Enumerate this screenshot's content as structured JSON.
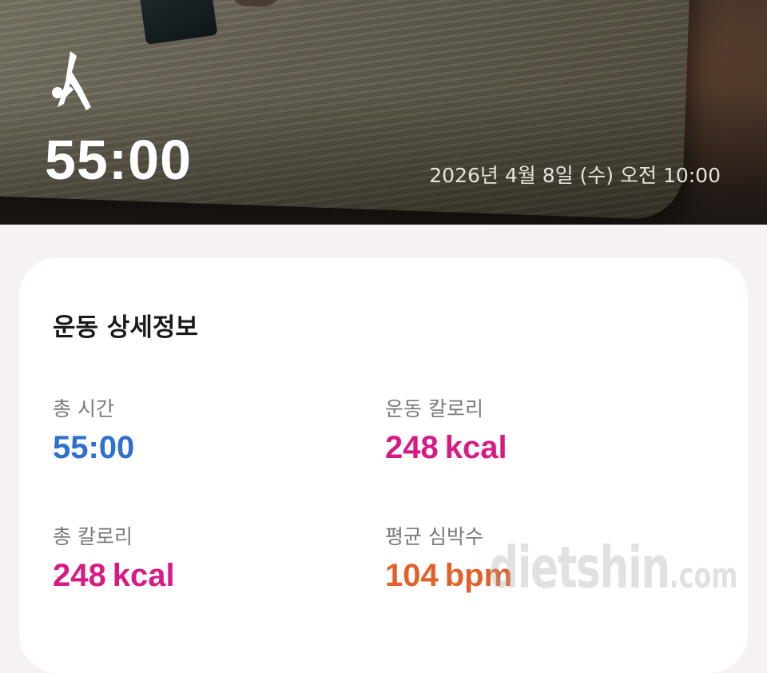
{
  "hero": {
    "icon": "yoga-icon",
    "duration": "55:00",
    "date": "2026년 4월 8일 (수) 오전 10:00"
  },
  "details": {
    "title": "운동 상세정보",
    "total_time": {
      "label": "총 시간",
      "value": "55:00",
      "color": "#2f6fd0"
    },
    "exercise_calories": {
      "label": "운동 칼로리",
      "value": "248",
      "unit": "kcal",
      "color": "#d81b84"
    },
    "total_calories": {
      "label": "총 칼로리",
      "value": "248",
      "unit": "kcal",
      "color": "#d81b84"
    },
    "avg_heart_rate": {
      "label": "평균 심박수",
      "value": "104",
      "unit": "bpm",
      "color": "#e0622a"
    }
  },
  "watermark": {
    "main": "dietshin",
    "suffix": ".com"
  }
}
